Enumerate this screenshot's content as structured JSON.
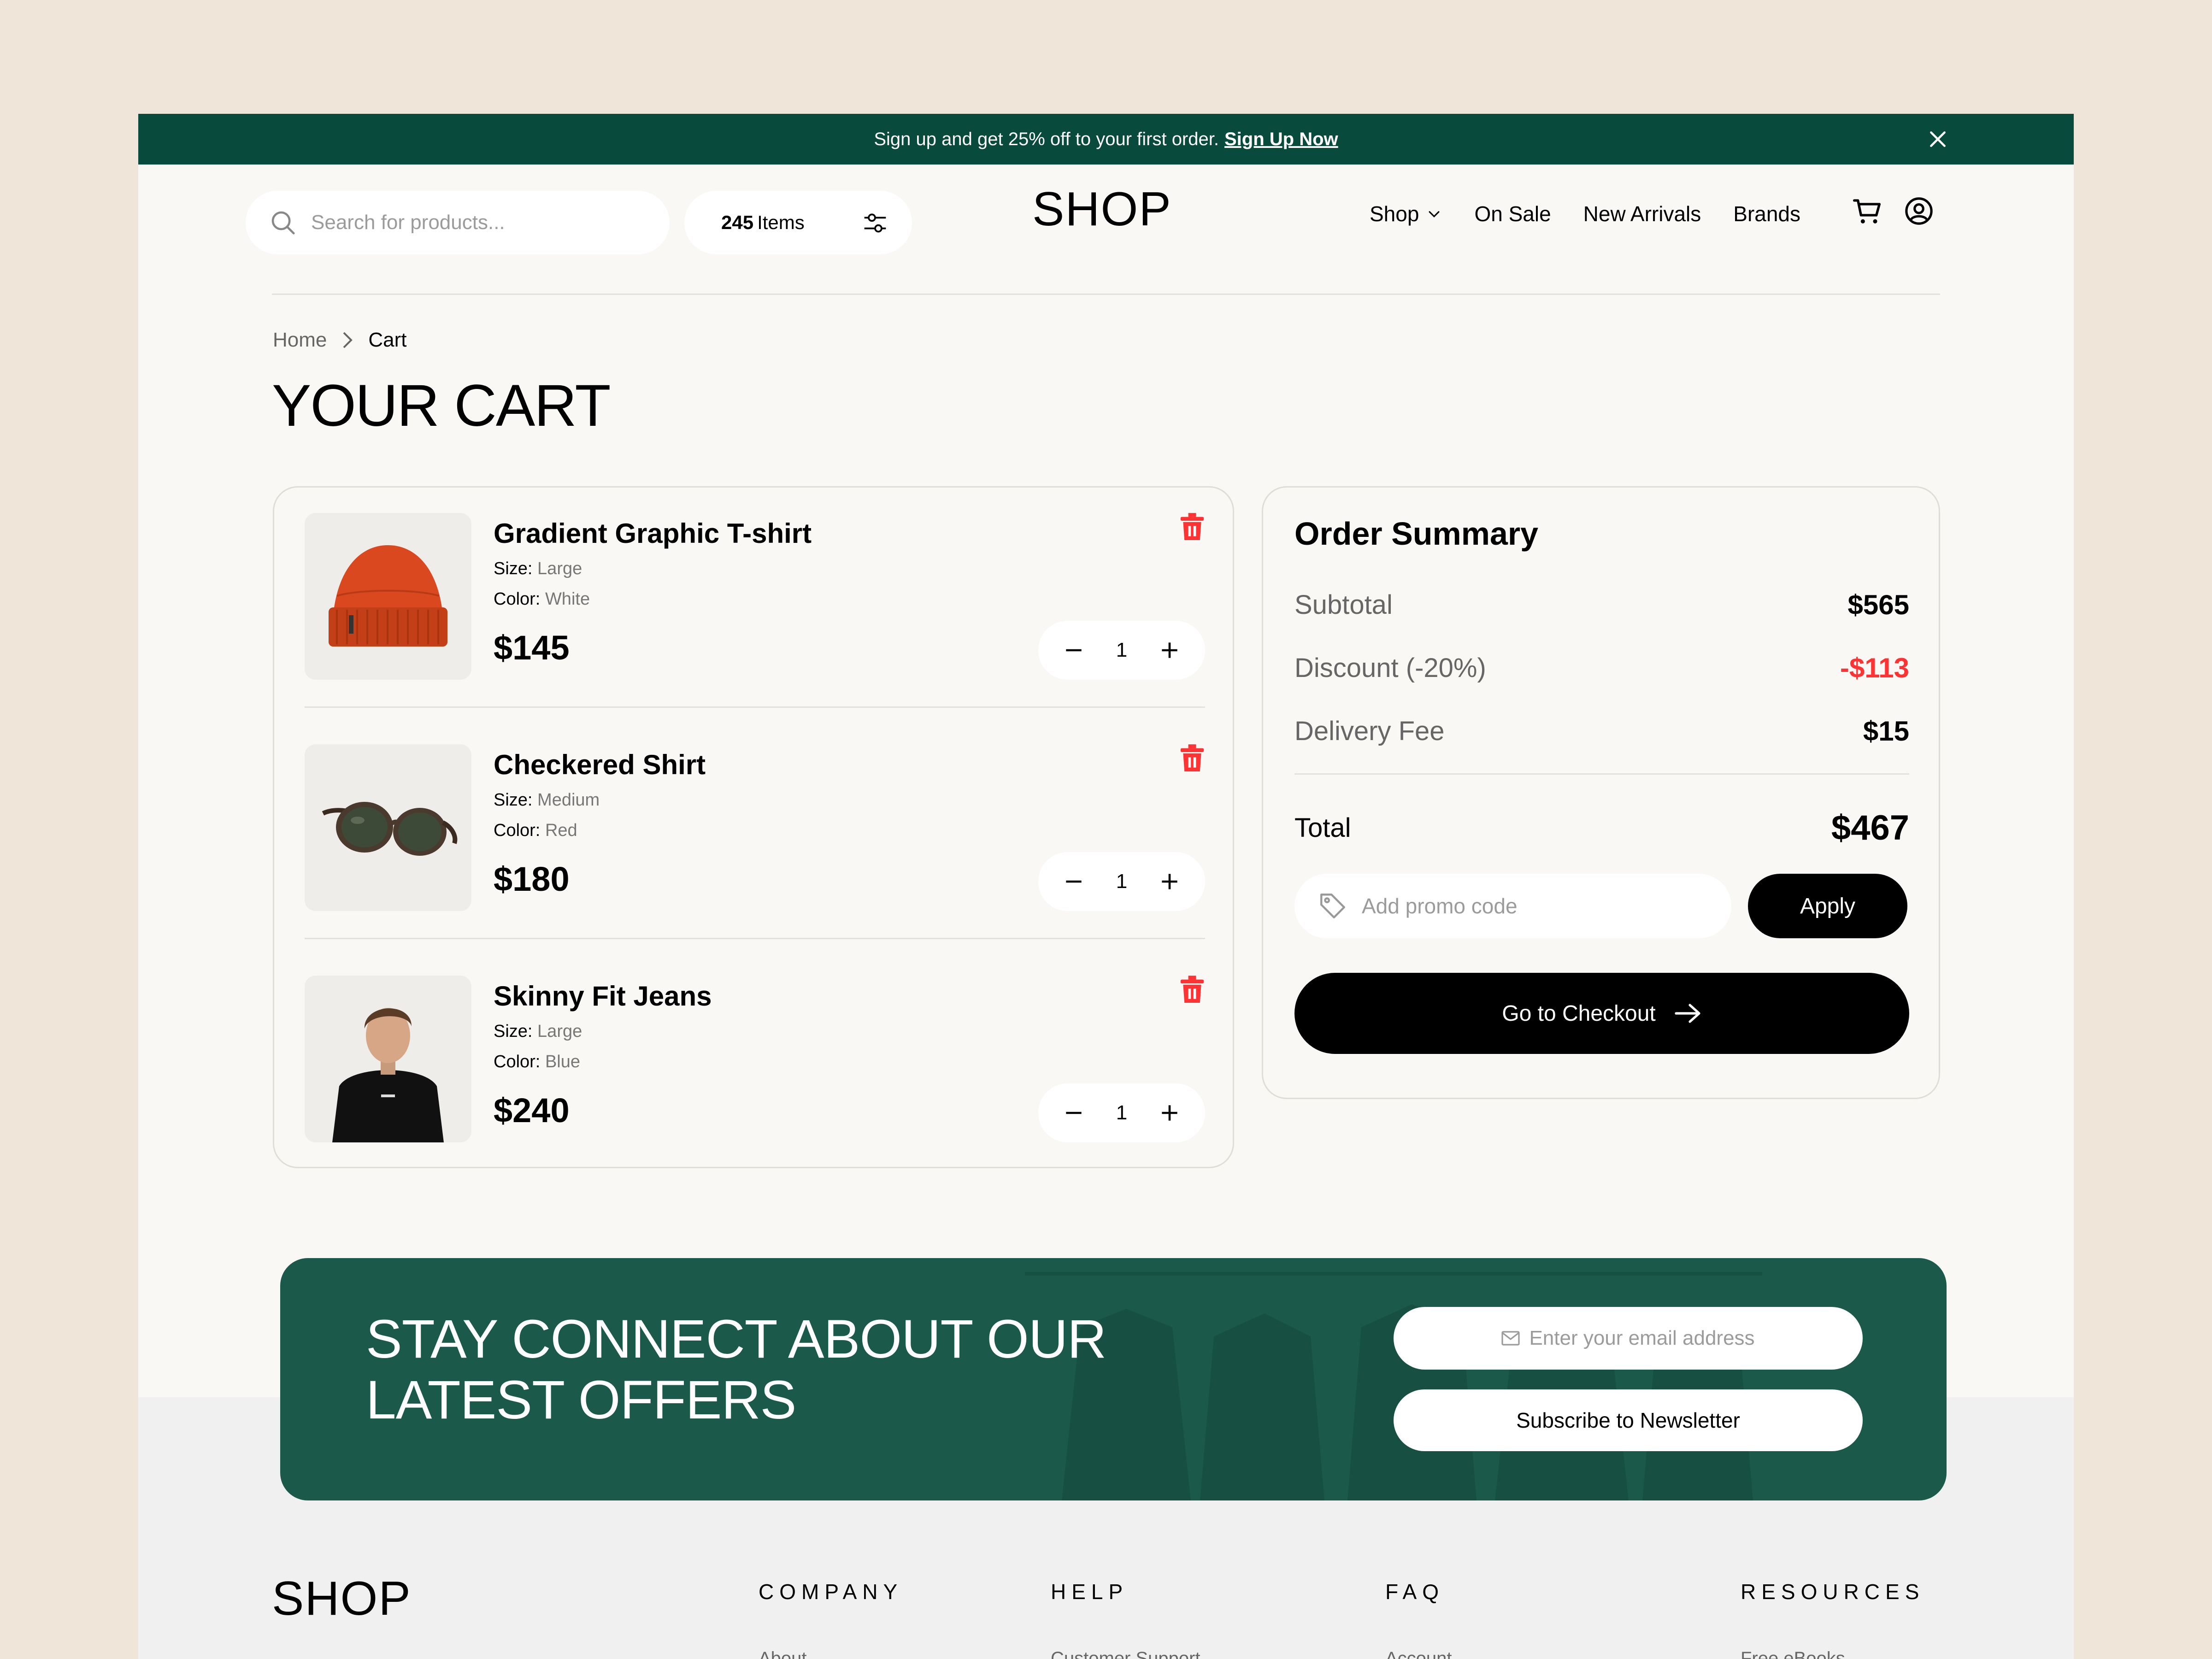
{
  "banner": {
    "text": "Sign up and get 25% off to your first order.",
    "link": "Sign Up Now",
    "close_icon": "close-icon"
  },
  "header": {
    "search_placeholder": "Search for products...",
    "items_count": "245",
    "items_label": "Items",
    "logo": "SHOP",
    "nav": [
      "Shop",
      "On Sale",
      "New Arrivals",
      "Brands"
    ],
    "icons": [
      "search-icon",
      "filter-icon",
      "chevron-down-icon",
      "cart-icon",
      "user-icon"
    ]
  },
  "breadcrumb": {
    "home": "Home",
    "current": "Cart"
  },
  "page_title": "YOUR CART",
  "cart_items": [
    {
      "name": "Gradient Graphic T-shirt",
      "size_label": "Size:",
      "size": "Large",
      "color_label": "Color:",
      "color": "White",
      "price": "$145",
      "qty": "1",
      "image": "beanie"
    },
    {
      "name": "Checkered Shirt",
      "size_label": "Size:",
      "size": "Medium",
      "color_label": "Color:",
      "color": "Red",
      "price": "$180",
      "qty": "1",
      "image": "sunglasses"
    },
    {
      "name": "Skinny Fit Jeans",
      "size_label": "Size:",
      "size": "Large",
      "color_label": "Color:",
      "color": "Blue",
      "price": "$240",
      "qty": "1",
      "image": "person-tshirt"
    }
  ],
  "summary": {
    "title": "Order Summary",
    "subtotal_label": "Subtotal",
    "subtotal": "$565",
    "discount_label": "Discount (-20%)",
    "discount": "-$113",
    "delivery_label": "Delivery Fee",
    "delivery": "$15",
    "total_label": "Total",
    "total": "$467",
    "promo_placeholder": "Add promo code",
    "apply_label": "Apply",
    "checkout_label": "Go to Checkout"
  },
  "newsletter": {
    "line1": "STAY CONNECT ABOUT OUR",
    "line2": "LATEST OFFERS",
    "email_placeholder": "Enter your email address",
    "subscribe_label": "Subscribe to Newsletter"
  },
  "footer": {
    "logo": "SHOP",
    "columns": [
      {
        "title": "COMPANY",
        "first_link": "About"
      },
      {
        "title": "HELP",
        "first_link": "Customer Support"
      },
      {
        "title": "FAQ",
        "first_link": "Account"
      },
      {
        "title": "RESOURCES",
        "first_link": "Free eBooks"
      }
    ]
  },
  "colors": {
    "brand_green": "#084a3c",
    "newsletter_green": "#1b5a4b",
    "discount_red": "#ff3333",
    "trash_red": "#ff3333",
    "background": "#efe6d9"
  }
}
